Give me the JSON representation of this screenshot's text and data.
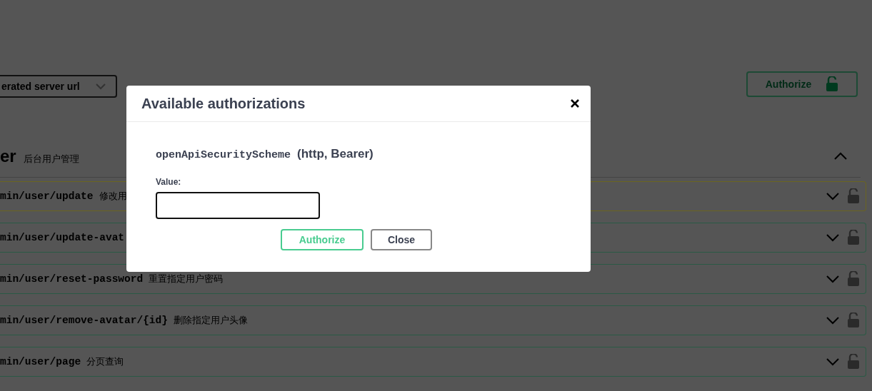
{
  "server_select": {
    "value": "erated server url"
  },
  "authorize_button": {
    "label": "Authorize",
    "locked": false
  },
  "tag": {
    "name": "er",
    "description": "后台用户管理",
    "expanded": true
  },
  "operations": [
    {
      "path": "min/user/update",
      "summary": "修改用",
      "color": "#6b6420",
      "expanded": false,
      "locked": false
    },
    {
      "path": "min/user/update-avat",
      "color": "#2a5a45",
      "expanded": false,
      "locked": false
    },
    {
      "path": "min/user/reset-password",
      "summary": "重置指定用户密码",
      "color": "#2a5a45",
      "expanded": false,
      "locked": false
    },
    {
      "path": "min/user/remove-avatar/{id}",
      "summary": "删除指定用户头像",
      "color": "#2a5a45",
      "expanded": false,
      "locked": false
    },
    {
      "path": "min/user/page",
      "summary": "分页查询",
      "color": "#2a5a45",
      "expanded": false,
      "locked": false
    }
  ],
  "dialog": {
    "title": "Available authorizations",
    "scheme_name": "openApiSecurityScheme",
    "scheme_type": "(http, Bearer)",
    "field_label": "Value:",
    "buttons": [
      {
        "label": "Authorize",
        "kind": "primary"
      },
      {
        "label": "Close",
        "kind": "secondary"
      }
    ]
  }
}
